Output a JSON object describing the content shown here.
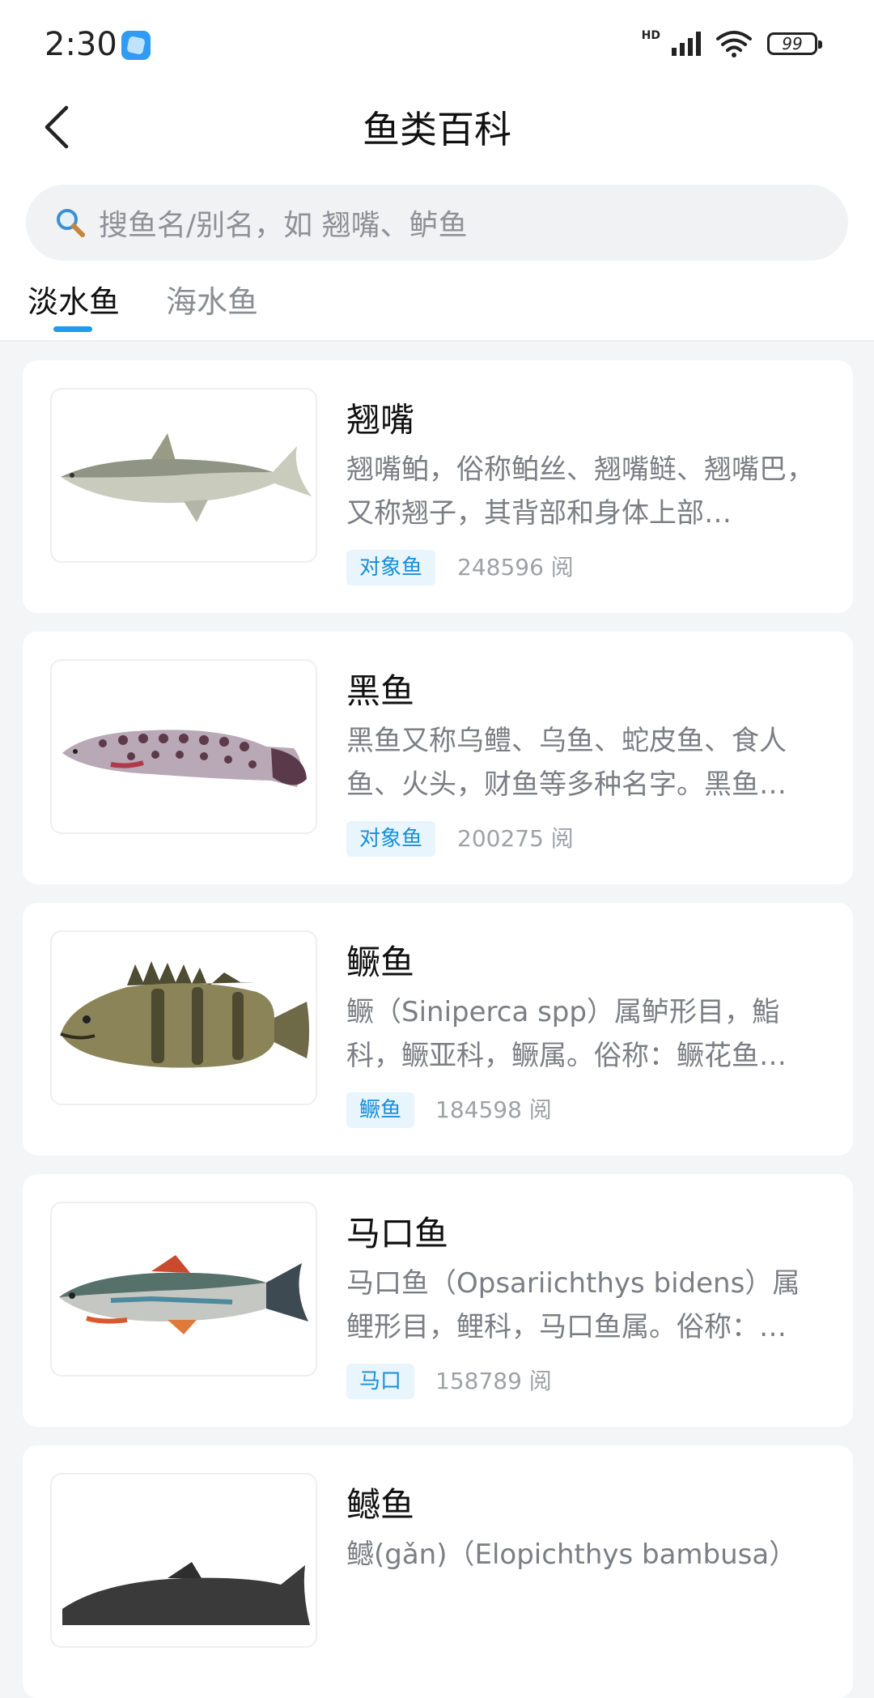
{
  "status_bar": {
    "time": "2:30",
    "network_label": "HD",
    "battery": "99",
    "icons": [
      "app-notification-icon",
      "signal-icon",
      "wifi-icon",
      "battery-icon"
    ]
  },
  "header": {
    "title": "鱼类百科",
    "back_icon": "chevron-left-icon"
  },
  "search": {
    "placeholder": "搜鱼名/别名，如 翘嘴、鲈鱼",
    "icon": "search-icon"
  },
  "tabs": [
    {
      "label": "淡水鱼",
      "active": true
    },
    {
      "label": "海水鱼",
      "active": false
    }
  ],
  "colors": {
    "accent": "#1f9bf0",
    "tag_bg": "#e8f5fc",
    "tag_text": "#1a8fd8",
    "page_bg": "#f4f5f7"
  },
  "fish": [
    {
      "name": "翘嘴",
      "desc": "翘嘴鲌，俗称鲌丝、翘嘴鲢、翘嘴巴，又称翘子，其背部和身体上部…",
      "tag": "对象鱼",
      "reads": "248596 阅"
    },
    {
      "name": "黑鱼",
      "desc": "黑鱼又称乌鳢、乌鱼、蛇皮鱼、食人鱼、火头，财鱼等多种名字。黑鱼…",
      "tag": "对象鱼",
      "reads": "200275 阅"
    },
    {
      "name": "鳜鱼",
      "desc": "鳜（Siniperca spp）属鲈形目，鮨科，鳜亚科，鳜属。俗称：鳜花鱼…",
      "tag": "鳜鱼",
      "reads": "184598 阅"
    },
    {
      "name": "马口鱼",
      "desc": "马口鱼（Opsariichthys bidens）属鲤形目，鲤科，马口鱼属。俗称：…",
      "tag": "马口",
      "reads": "158789 阅"
    },
    {
      "name": "鳡鱼",
      "desc": "鳡(gǎn)（Elopichthys bambusa）",
      "tag": "",
      "reads": ""
    }
  ]
}
